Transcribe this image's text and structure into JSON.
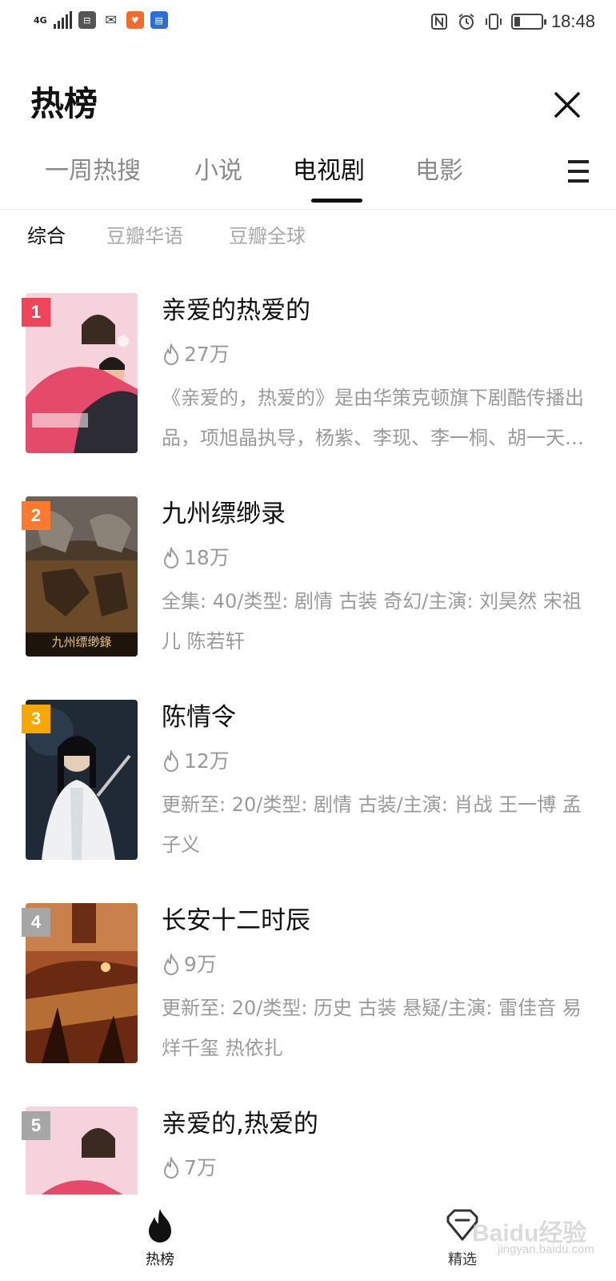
{
  "status_bar": {
    "network": "4G",
    "time": "18:48",
    "battery_percent": 22,
    "icons": [
      "signal-icon",
      "speed-icon",
      "wechat-icon",
      "app-icon",
      "app-icon",
      "nfc-icon",
      "alarm-icon",
      "vibrate-icon",
      "battery-icon"
    ]
  },
  "header": {
    "title": "热榜"
  },
  "tabs": [
    {
      "label": "一周热搜"
    },
    {
      "label": "小说"
    },
    {
      "label": "电视剧"
    },
    {
      "label": "电影"
    }
  ],
  "active_tab": "电视剧",
  "subtabs": [
    {
      "label": "综合"
    },
    {
      "label": "豆瓣华语"
    },
    {
      "label": "豆瓣全球"
    }
  ],
  "active_subtab": "综合",
  "items": [
    {
      "rank": "1",
      "title": "亲爱的热爱的",
      "heat": "27万",
      "desc": "《亲爱的，热爱的》是由华策克顿旗下剧酷传播出品，项旭晶执导，杨紫、李现、李一桐、胡一天主演的都市爱情剧。",
      "rank_color": "#f0445b"
    },
    {
      "rank": "2",
      "title": "九州缥缈录",
      "heat": "18万",
      "desc": "全集: 40/类型: 剧情 古装 奇幻/主演: 刘昊然 宋祖儿 陈若轩",
      "rank_color": "#ff7a30"
    },
    {
      "rank": "3",
      "title": "陈情令",
      "heat": "12万",
      "desc": "更新至: 20/类型: 剧情 古装/主演: 肖战 王一博 孟子义",
      "rank_color": "#f6a800"
    },
    {
      "rank": "4",
      "title": "长安十二时辰",
      "heat": "9万",
      "desc": "更新至: 20/类型: 历史 古装 悬疑/主演: 雷佳音 易烊千玺 热依扎",
      "rank_color": "#a6a6a6"
    },
    {
      "rank": "5",
      "title": "亲爱的,热爱的",
      "heat": "7万",
      "desc": "",
      "rank_color": "#a6a6a6"
    }
  ],
  "bottom_nav": [
    {
      "label": "热榜"
    },
    {
      "label": "精选"
    }
  ],
  "watermark": {
    "text": "Baidu经验",
    "sub": "jingyan.baidu.com"
  }
}
